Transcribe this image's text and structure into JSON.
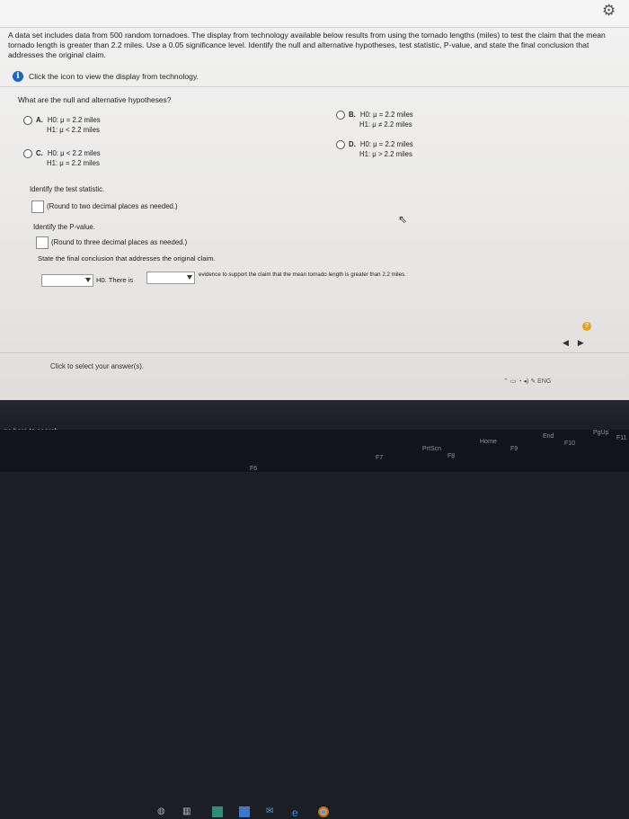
{
  "problem": {
    "text": "A data set includes data from 500 random tornadoes. The display from technology available below results from using the tornado lengths (miles) to test the claim that the mean tornado length is greater than 2.2 miles. Use a 0.05 significance level. Identify the null and alternative hypotheses, test statistic, P-value, and state the final conclusion that addresses the original claim.",
    "info_link": "Click the icon to view the display from technology."
  },
  "question": {
    "prompt": "What are the null and alternative hypotheses?",
    "options": [
      {
        "letter": "A.",
        "h0": "H0: μ = 2.2 miles",
        "h1": "H1: μ < 2.2 miles"
      },
      {
        "letter": "B.",
        "h0": "H0: μ = 2.2 miles",
        "h1": "H1: μ ≠ 2.2 miles"
      },
      {
        "letter": "C.",
        "h0": "H0: μ < 2.2 miles",
        "h1": "H1: μ = 2.2 miles"
      },
      {
        "letter": "D.",
        "h0": "H0: μ = 2.2 miles",
        "h1": "H1: μ > 2.2 miles"
      }
    ]
  },
  "test_statistic": {
    "label": "Identify the test statistic.",
    "hint": "(Round to two decimal places as needed.)"
  },
  "p_value": {
    "label": "Identify the P-value.",
    "hint": "(Round to three decimal places as needed.)"
  },
  "conclusion": {
    "label": "State the final conclusion that addresses the original claim.",
    "h0_text": "H0. There is",
    "tail_text": "evidence to support the claim that the mean tornado length is greater than 2.2 miles."
  },
  "footer": {
    "help": "?",
    "select_text": "Click to select your answer(s)."
  },
  "tray": {
    "lang": "ENG"
  },
  "taskbar": {
    "search": "pe here to search"
  },
  "keyboard": {
    "keys": [
      "F6",
      "F7",
      "PrtScn",
      "F8",
      "Home",
      "F9",
      "End",
      "F10",
      "PgUp",
      "F11"
    ]
  }
}
